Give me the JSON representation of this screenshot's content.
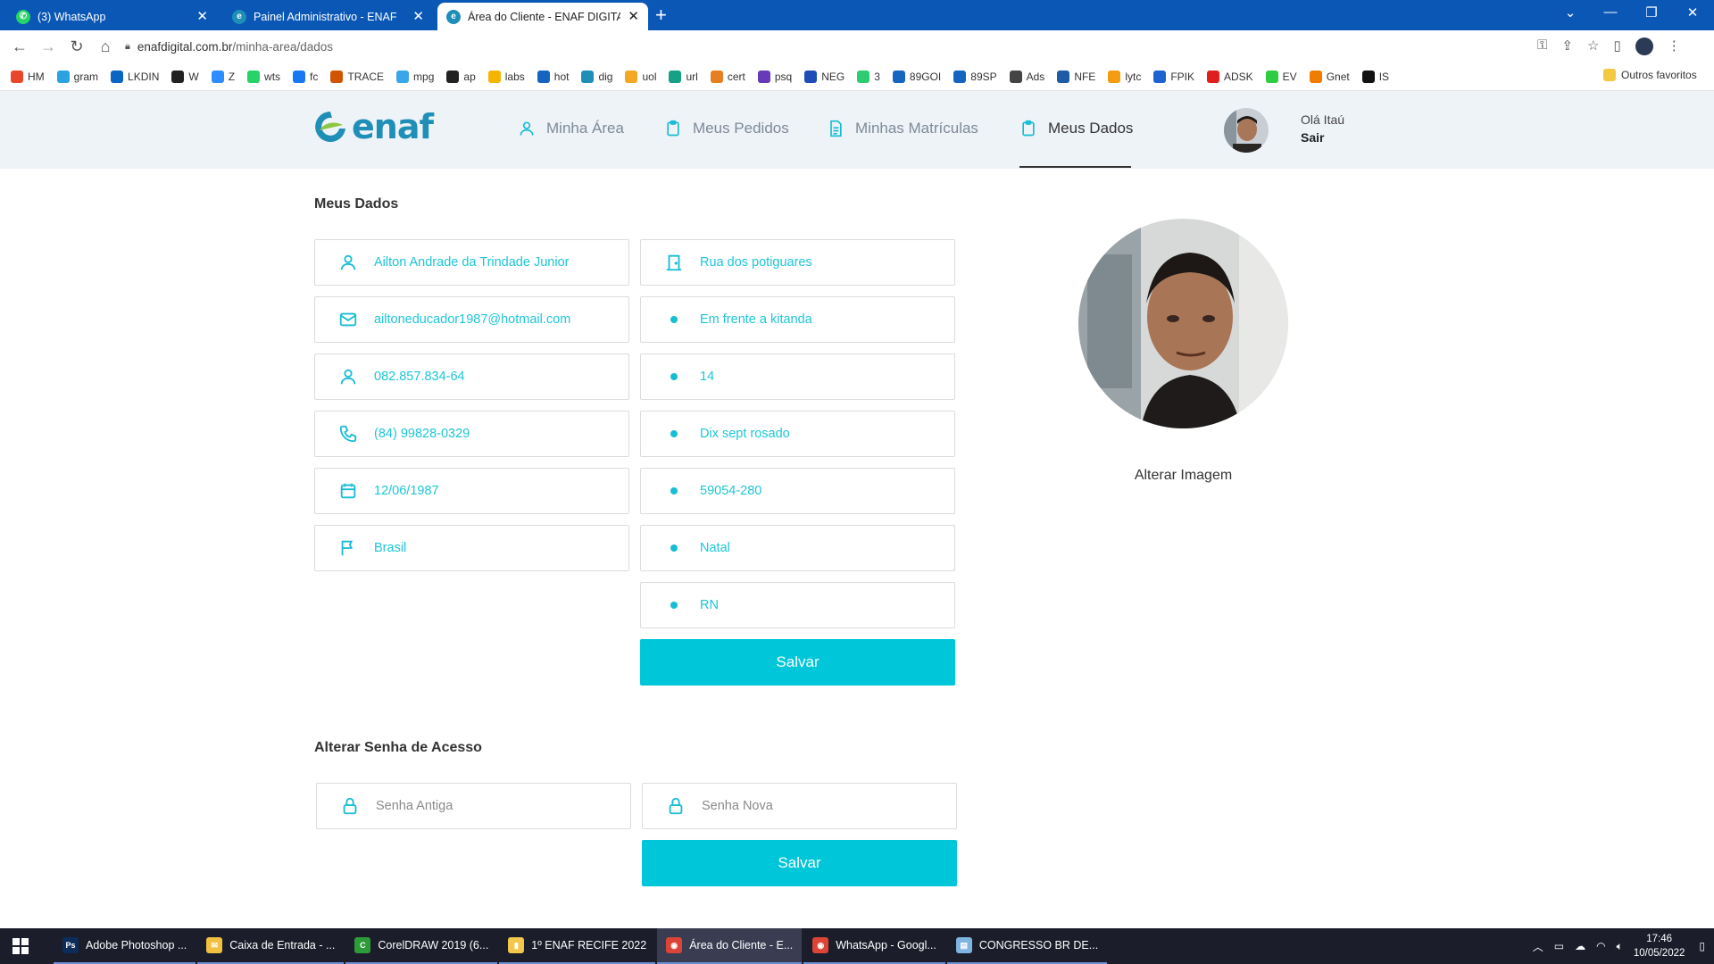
{
  "browser": {
    "tabs": [
      {
        "label": "(3) WhatsApp",
        "icon": "whatsapp-icon",
        "color": "#25d366"
      },
      {
        "label": "Painel Administrativo - ENAF",
        "icon": "enaf-icon",
        "color": "#1f8fb8"
      },
      {
        "label": "Área do Cliente - ENAF DIGITAL",
        "icon": "enaf-icon",
        "color": "#1f8fb8"
      }
    ],
    "url_domain": "enafdigital.com.br",
    "url_path": "/minha-area/dados",
    "bookmarks": [
      {
        "label": "HM",
        "color": "#e8472b"
      },
      {
        "label": "gram",
        "color": "#2aa3e0"
      },
      {
        "label": "LKDIN",
        "color": "#0a66c2"
      },
      {
        "label": "W",
        "color": "#222222"
      },
      {
        "label": "Z",
        "color": "#2d8cff"
      },
      {
        "label": "wts",
        "color": "#25d366"
      },
      {
        "label": "fc",
        "color": "#1877f2"
      },
      {
        "label": "TRACE",
        "color": "#d35400"
      },
      {
        "label": "mpg",
        "color": "#3aa6e8"
      },
      {
        "label": "ap",
        "color": "#222222"
      },
      {
        "label": "labs",
        "color": "#f4b400"
      },
      {
        "label": "hot",
        "color": "#1565c0"
      },
      {
        "label": "dig",
        "color": "#1f8fb8"
      },
      {
        "label": "uol",
        "color": "#f5a623"
      },
      {
        "label": "url",
        "color": "#16a085"
      },
      {
        "label": "cert",
        "color": "#e67e22"
      },
      {
        "label": "psq",
        "color": "#673ab7"
      },
      {
        "label": "NEG",
        "color": "#1e4db7"
      },
      {
        "label": "3",
        "color": "#2ecc71"
      },
      {
        "label": "89GOI",
        "color": "#1565c0"
      },
      {
        "label": "89SP",
        "color": "#1565c0"
      },
      {
        "label": "Ads",
        "color": "#444444"
      },
      {
        "label": "NFE",
        "color": "#1f5aa6"
      },
      {
        "label": "lytc",
        "color": "#f39c12"
      },
      {
        "label": "FPIK",
        "color": "#1e63d0"
      },
      {
        "label": "ADSK",
        "color": "#e01e1e"
      },
      {
        "label": "EV",
        "color": "#2ecc40"
      },
      {
        "label": "Gnet",
        "color": "#f07d00"
      },
      {
        "label": "IS",
        "color": "#111111"
      }
    ],
    "other_bookmarks": "Outros favoritos"
  },
  "site": {
    "logo_text": "enaf",
    "nav": [
      {
        "label": "Minha Área",
        "icon": "user-icon",
        "active": false
      },
      {
        "label": "Meus Pedidos",
        "icon": "clipboard-icon",
        "active": false
      },
      {
        "label": "Minhas Matrículas",
        "icon": "document-icon",
        "active": false
      },
      {
        "label": "Meus Dados",
        "icon": "clipboard-icon",
        "active": true
      }
    ],
    "user": {
      "greeting": "Olá Itaú",
      "logout": "Sair"
    }
  },
  "profile": {
    "title": "Meus Dados",
    "left_fields": [
      {
        "value": "Ailton Andrade da Trindade Junior",
        "icon": "user-icon"
      },
      {
        "value": "ailtoneducador1987@hotmail.com",
        "icon": "mail-icon"
      },
      {
        "value": "082.857.834-64",
        "icon": "user-icon"
      },
      {
        "value": "(84) 99828-0329",
        "icon": "phone-icon"
      },
      {
        "value": "12/06/1987",
        "icon": "calendar-icon"
      },
      {
        "value": "Brasil",
        "icon": "flag-icon"
      }
    ],
    "right_fields": [
      {
        "value": "Rua dos potiguares",
        "icon": "door-icon"
      },
      {
        "value": "Em frente a kitanda",
        "icon": "dot-icon"
      },
      {
        "value": "14",
        "icon": "dot-icon"
      },
      {
        "value": "Dix sept rosado",
        "icon": "dot-icon"
      },
      {
        "value": "59054-280",
        "icon": "dot-icon"
      },
      {
        "value": "Natal",
        "icon": "dot-icon"
      },
      {
        "value": "RN",
        "icon": "dot-icon"
      }
    ],
    "save_label": "Salvar",
    "change_image_label": "Alterar Imagem"
  },
  "password": {
    "title": "Alterar Senha de Acesso",
    "old_placeholder": "Senha Antiga",
    "new_placeholder": "Senha Nova",
    "save_label": "Salvar"
  },
  "taskbar": {
    "items": [
      {
        "label": "Adobe Photoshop ...",
        "color": "#0c2d5a",
        "glyph": "Ps",
        "active": false
      },
      {
        "label": "Caixa de Entrada - ...",
        "color": "#f0c040",
        "glyph": "✉",
        "active": false
      },
      {
        "label": "CorelDRAW 2019 (6...",
        "color": "#2d9b3a",
        "glyph": "C",
        "active": false
      },
      {
        "label": "1º ENAF RECIFE 2022",
        "color": "#f3c74b",
        "glyph": "▮",
        "active": false
      },
      {
        "label": "Área do Cliente - E...",
        "color": "#db4437",
        "glyph": "◉",
        "active": true
      },
      {
        "label": "WhatsApp - Googl...",
        "color": "#db4437",
        "glyph": "◉",
        "active": false
      },
      {
        "label": "CONGRESSO BR DE...",
        "color": "#7fb3e0",
        "glyph": "▤",
        "active": false
      }
    ],
    "time": "17:46",
    "date": "10/05/2022"
  }
}
